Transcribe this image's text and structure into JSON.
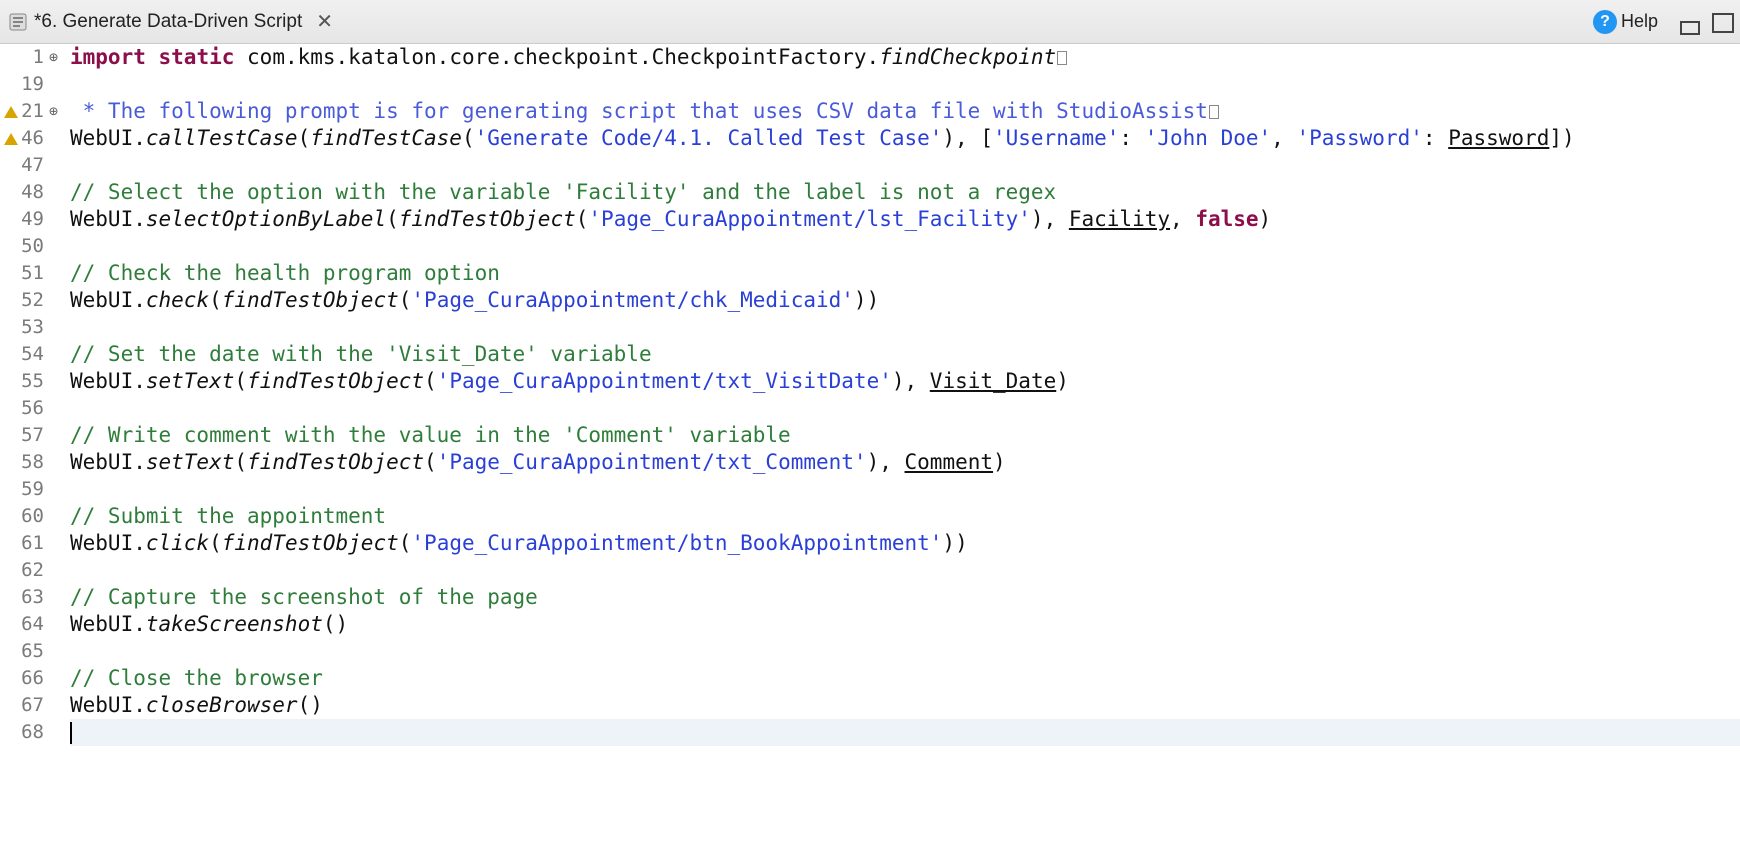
{
  "tab": {
    "title": "*6. Generate Data-Driven Script",
    "close_glyph": "✕"
  },
  "toolbar": {
    "help_label": "Help",
    "help_glyph": "?"
  },
  "gutter": {
    "fold_glyph": "⊕"
  },
  "lines": [
    {
      "n": 1,
      "fold": true,
      "warn": false,
      "tokens": [
        {
          "t": "import ",
          "c": "kw"
        },
        {
          "t": "static ",
          "c": "kw"
        },
        {
          "t": "com.kms.katalon.core.checkpoint.CheckpointFactory.",
          "c": "pkg"
        },
        {
          "t": "findCheckpoint",
          "c": "fn"
        },
        {
          "t": "▯",
          "c": "collapse"
        }
      ]
    },
    {
      "n": 19,
      "fold": false,
      "warn": false,
      "tokens": []
    },
    {
      "n": 21,
      "fold": true,
      "warn": true,
      "tokens": [
        {
          "t": " * The following prompt is for generating script that uses CSV data file with StudioAssist",
          "c": "doc"
        },
        {
          "t": "▯",
          "c": "collapse"
        }
      ]
    },
    {
      "n": 46,
      "fold": false,
      "warn": true,
      "tokens": [
        {
          "t": "WebUI.",
          "c": "pkg"
        },
        {
          "t": "callTestCase",
          "c": "mth"
        },
        {
          "t": "(",
          "c": "pkg"
        },
        {
          "t": "findTestCase",
          "c": "fn"
        },
        {
          "t": "(",
          "c": "pkg"
        },
        {
          "t": "'Generate Code/4.1. Called Test Case'",
          "c": "str"
        },
        {
          "t": "), [",
          "c": "pkg"
        },
        {
          "t": "'Username'",
          "c": "str"
        },
        {
          "t": ": ",
          "c": "pkg"
        },
        {
          "t": "'John Doe'",
          "c": "str"
        },
        {
          "t": ", ",
          "c": "pkg"
        },
        {
          "t": "'Password'",
          "c": "str"
        },
        {
          "t": ": ",
          "c": "pkg"
        },
        {
          "t": "Password",
          "c": "var"
        },
        {
          "t": "])",
          "c": "pkg"
        }
      ]
    },
    {
      "n": 47,
      "tokens": []
    },
    {
      "n": 48,
      "tokens": [
        {
          "t": "// Select the option with the variable 'Facility' and the label is not a regex",
          "c": "cmt"
        }
      ]
    },
    {
      "n": 49,
      "tokens": [
        {
          "t": "WebUI.",
          "c": "pkg"
        },
        {
          "t": "selectOptionByLabel",
          "c": "mth"
        },
        {
          "t": "(",
          "c": "pkg"
        },
        {
          "t": "findTestObject",
          "c": "fn"
        },
        {
          "t": "(",
          "c": "pkg"
        },
        {
          "t": "'Page_CuraAppointment/lst_Facility'",
          "c": "str"
        },
        {
          "t": "), ",
          "c": "pkg"
        },
        {
          "t": "Facility",
          "c": "var"
        },
        {
          "t": ", ",
          "c": "pkg"
        },
        {
          "t": "false",
          "c": "bool"
        },
        {
          "t": ")",
          "c": "pkg"
        }
      ]
    },
    {
      "n": 50,
      "tokens": []
    },
    {
      "n": 51,
      "tokens": [
        {
          "t": "// Check the health program option",
          "c": "cmt"
        }
      ]
    },
    {
      "n": 52,
      "tokens": [
        {
          "t": "WebUI.",
          "c": "pkg"
        },
        {
          "t": "check",
          "c": "mth"
        },
        {
          "t": "(",
          "c": "pkg"
        },
        {
          "t": "findTestObject",
          "c": "fn"
        },
        {
          "t": "(",
          "c": "pkg"
        },
        {
          "t": "'Page_CuraAppointment/chk_Medicaid'",
          "c": "str"
        },
        {
          "t": "))",
          "c": "pkg"
        }
      ]
    },
    {
      "n": 53,
      "tokens": []
    },
    {
      "n": 54,
      "tokens": [
        {
          "t": "// Set the date with the 'Visit_Date' variable",
          "c": "cmt"
        }
      ]
    },
    {
      "n": 55,
      "tokens": [
        {
          "t": "WebUI.",
          "c": "pkg"
        },
        {
          "t": "setText",
          "c": "mth"
        },
        {
          "t": "(",
          "c": "pkg"
        },
        {
          "t": "findTestObject",
          "c": "fn"
        },
        {
          "t": "(",
          "c": "pkg"
        },
        {
          "t": "'Page_CuraAppointment/txt_VisitDate'",
          "c": "str"
        },
        {
          "t": "), ",
          "c": "pkg"
        },
        {
          "t": "Visit_Date",
          "c": "var"
        },
        {
          "t": ")",
          "c": "pkg"
        }
      ]
    },
    {
      "n": 56,
      "tokens": []
    },
    {
      "n": 57,
      "tokens": [
        {
          "t": "// Write comment with the value in the 'Comment' variable",
          "c": "cmt"
        }
      ]
    },
    {
      "n": 58,
      "tokens": [
        {
          "t": "WebUI.",
          "c": "pkg"
        },
        {
          "t": "setText",
          "c": "mth"
        },
        {
          "t": "(",
          "c": "pkg"
        },
        {
          "t": "findTestObject",
          "c": "fn"
        },
        {
          "t": "(",
          "c": "pkg"
        },
        {
          "t": "'Page_CuraAppointment/txt_Comment'",
          "c": "str"
        },
        {
          "t": "), ",
          "c": "pkg"
        },
        {
          "t": "Comment",
          "c": "var"
        },
        {
          "t": ")",
          "c": "pkg"
        }
      ]
    },
    {
      "n": 59,
      "tokens": []
    },
    {
      "n": 60,
      "tokens": [
        {
          "t": "// Submit the appointment",
          "c": "cmt"
        }
      ]
    },
    {
      "n": 61,
      "tokens": [
        {
          "t": "WebUI.",
          "c": "pkg"
        },
        {
          "t": "click",
          "c": "mth"
        },
        {
          "t": "(",
          "c": "pkg"
        },
        {
          "t": "findTestObject",
          "c": "fn"
        },
        {
          "t": "(",
          "c": "pkg"
        },
        {
          "t": "'Page_CuraAppointment/btn_BookAppointment'",
          "c": "str"
        },
        {
          "t": "))",
          "c": "pkg"
        }
      ]
    },
    {
      "n": 62,
      "tokens": []
    },
    {
      "n": 63,
      "tokens": [
        {
          "t": "// Capture the screenshot of the page",
          "c": "cmt"
        }
      ]
    },
    {
      "n": 64,
      "tokens": [
        {
          "t": "WebUI.",
          "c": "pkg"
        },
        {
          "t": "takeScreenshot",
          "c": "mth"
        },
        {
          "t": "()",
          "c": "pkg"
        }
      ]
    },
    {
      "n": 65,
      "tokens": []
    },
    {
      "n": 66,
      "tokens": [
        {
          "t": "// Close the browser",
          "c": "cmt"
        }
      ]
    },
    {
      "n": 67,
      "tokens": [
        {
          "t": "WebUI.",
          "c": "pkg"
        },
        {
          "t": "closeBrowser",
          "c": "mth"
        },
        {
          "t": "()",
          "c": "pkg"
        }
      ]
    },
    {
      "n": 68,
      "current": true,
      "tokens": [
        {
          "t": "",
          "c": "cursor"
        }
      ]
    }
  ]
}
